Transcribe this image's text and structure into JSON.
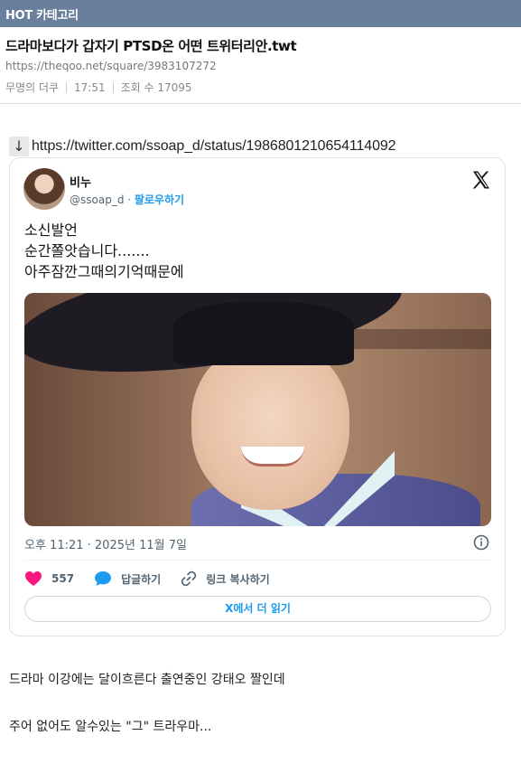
{
  "header": {
    "category_label": "HOT 카테고리"
  },
  "post": {
    "title": "드라마보다가 갑자기 PTSD온 어떤 트위터리안.twt",
    "url": "https://theqoo.net/square/3983107272",
    "author": "무명의 더쿠",
    "time": "17:51",
    "views": "조회 수 17095"
  },
  "link": {
    "arrow": "↓",
    "text": "https://twitter.com/ssoap_d/status/1986801210654114092"
  },
  "tweet": {
    "author_name": "비누",
    "handle": "@ssoap_d",
    "dot": " · ",
    "follow_label": "팔로우하기",
    "lines": [
      "소신발언",
      "순간쫄앗습니다.......",
      "아주잠깐그때의기억때문에"
    ],
    "timestamp": "오후 11:21 · 2025년 11월 7일",
    "like_count": "557",
    "reply_label": "답글하기",
    "copy_link_label": "링크 복사하기",
    "read_more_label": "X에서 더 읽기",
    "colors": {
      "accent": "#1d9bf0",
      "like": "#f91880"
    }
  },
  "body": {
    "paragraph1": "드라마 이강에는 달이흐른다 출연중인 강태오 짤인데",
    "paragraph2": "주어 없어도 알수있는 \"그\" 트라우마..."
  },
  "icons": [
    "x-logo-icon",
    "info-icon",
    "heart-icon",
    "reply-bubble-icon",
    "link-icon",
    "down-arrow-icon"
  ]
}
